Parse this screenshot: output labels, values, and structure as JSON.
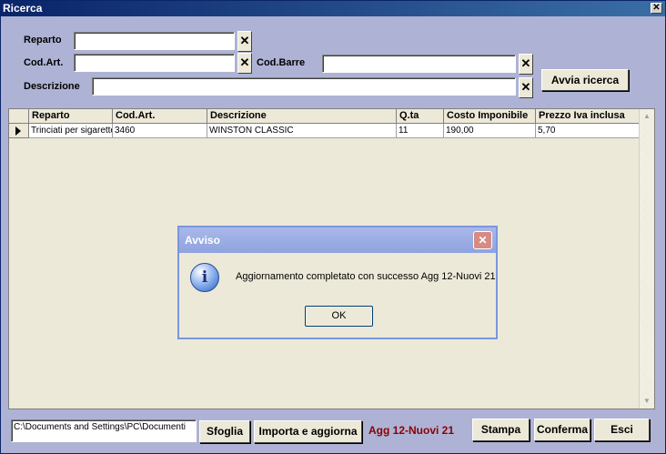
{
  "window": {
    "title": "Ricerca",
    "close_glyph": "✕"
  },
  "search": {
    "reparto_label": "Reparto",
    "reparto_value": "",
    "codart_label": "Cod.Art.",
    "codart_value": "",
    "codbarre_label": "Cod.Barre",
    "codbarre_value": "",
    "descrizione_label": "Descrizione",
    "descrizione_value": "",
    "clear_glyph": "✕",
    "search_button": "Avvia ricerca"
  },
  "grid": {
    "columns": [
      "Reparto",
      "Cod.Art.",
      "Descrizione",
      "Q.ta",
      "Costo Imponibile",
      "Prezzo Iva inclusa"
    ],
    "rows": [
      [
        "Trinciati per sigarette",
        "3460",
        "WINSTON CLASSIC",
        "11",
        "190,00",
        "5,70"
      ]
    ],
    "scroll_up": "▲",
    "scroll_down": "▼"
  },
  "dialog": {
    "title": "Avviso",
    "close_glyph": "✕",
    "icon": "info-icon",
    "icon_glyph": "i",
    "message": "Aggiornamento completato con successo Agg 12-Nuovi 21",
    "ok_button": "OK"
  },
  "footer": {
    "path_value": "C:\\Documents and Settings\\PC\\Documenti",
    "browse_button": "Sfoglia",
    "import_button": "Importa e aggiorna",
    "status_text": "Agg 12-Nuovi 21",
    "print_button": "Stampa",
    "confirm_button": "Conferma",
    "exit_button": "Esci"
  },
  "colors": {
    "window_bg": "#aeb3d5",
    "titlebar": "#0a246a",
    "status_text": "#8b0000",
    "dialog_title": "#8ea3df"
  }
}
